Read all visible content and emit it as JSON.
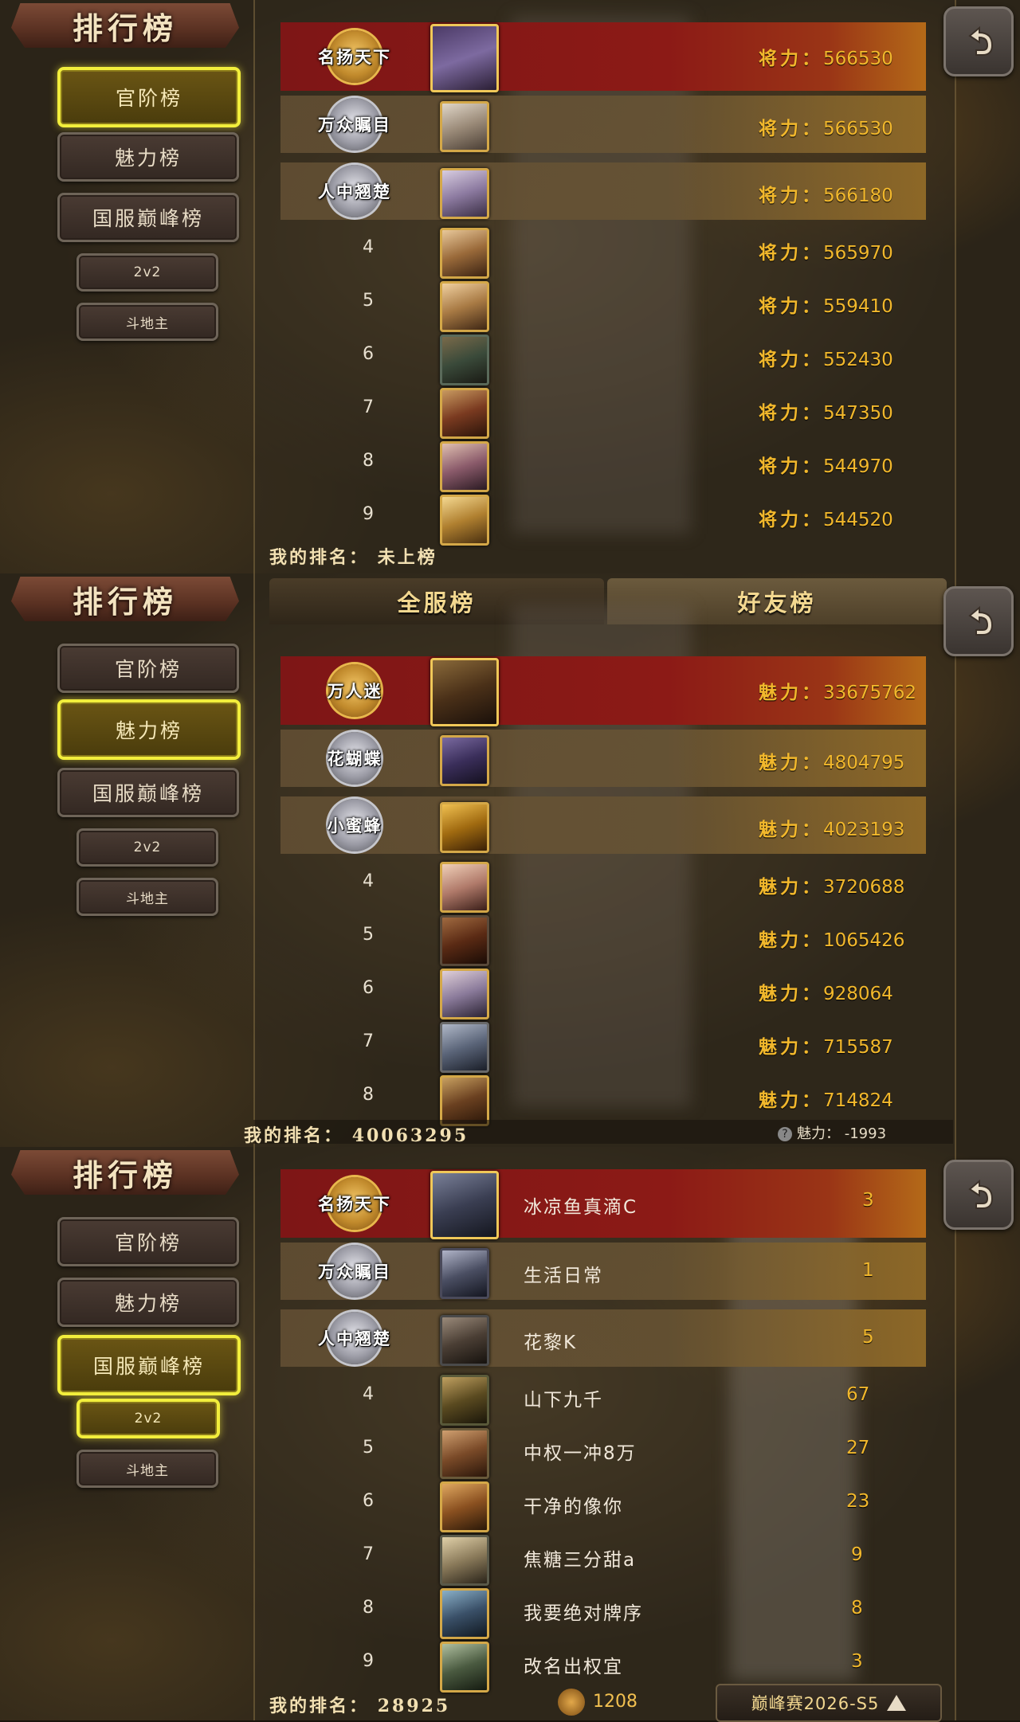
{
  "window": {
    "title": "排行榜"
  },
  "sidebar": {
    "items": [
      {
        "label": "官阶榜"
      },
      {
        "label": "魅力榜"
      },
      {
        "label": "国服巅峰榜"
      },
      {
        "label": "2v2"
      },
      {
        "label": "斗地主"
      }
    ]
  },
  "panels": [
    {
      "active_sidebar": "官阶榜",
      "score_label": "将力：",
      "rows": [
        {
          "rank": "1",
          "medal_text": "名扬天下",
          "score": "566530"
        },
        {
          "rank": "2",
          "medal_text": "万众瞩目",
          "score": "566530"
        },
        {
          "rank": "3",
          "medal_text": "人中翘楚",
          "score": "566180"
        },
        {
          "rank": "4",
          "score": "565970"
        },
        {
          "rank": "5",
          "score": "559410"
        },
        {
          "rank": "6",
          "score": "552430"
        },
        {
          "rank": "7",
          "score": "547350"
        },
        {
          "rank": "8",
          "score": "544970"
        },
        {
          "rank": "9",
          "score": "544520"
        }
      ],
      "my_rank_label": "我的排名：",
      "my_rank_value": "未上榜"
    },
    {
      "active_sidebar": "魅力榜",
      "tabs": [
        {
          "label": "全服榜"
        },
        {
          "label": "好友榜"
        }
      ],
      "score_label": "魅力：",
      "rows": [
        {
          "rank": "1",
          "medal_text": "万人迷",
          "score": "33675762"
        },
        {
          "rank": "2",
          "medal_text": "花蝴蝶",
          "score": "4804795"
        },
        {
          "rank": "3",
          "medal_text": "小蜜蜂",
          "score": "4023193"
        },
        {
          "rank": "4",
          "score": "3720688"
        },
        {
          "rank": "5",
          "score": "1065426"
        },
        {
          "rank": "6",
          "score": "928064"
        },
        {
          "rank": "7",
          "score": "715587"
        },
        {
          "rank": "8",
          "score": "714824"
        }
      ],
      "my_rank_label": "我的排名：",
      "my_rank_value": "40063295",
      "my_score_label": "魅力：",
      "my_score_value": "-1993"
    },
    {
      "active_sidebar": "国服巅峰榜",
      "active_sub": "2v2",
      "rows": [
        {
          "rank": "1",
          "medal_text": "名扬天下",
          "name": "冰凉鱼真滴C",
          "score_tail": "3"
        },
        {
          "rank": "2",
          "medal_text": "万众瞩目",
          "name": "生活日常",
          "score_tail": "1"
        },
        {
          "rank": "3",
          "medal_text": "人中翘楚",
          "name": "花黎K",
          "score_tail": "5"
        },
        {
          "rank": "4",
          "name": "山下九千",
          "score_tail": "67"
        },
        {
          "rank": "5",
          "name": "中权一冲8万",
          "score_tail": "27"
        },
        {
          "rank": "6",
          "name": "干净的像你",
          "score_tail": "23"
        },
        {
          "rank": "7",
          "name": "焦糖三分甜a",
          "score_tail": "9"
        },
        {
          "rank": "8",
          "name": "我要绝对牌序",
          "score_tail": "8"
        },
        {
          "rank": "9",
          "name": "改名出权宜",
          "score_tail": "3"
        }
      ],
      "my_rank_label": "我的排名：",
      "my_rank_value": "28925",
      "coins": "1208",
      "season": "巅峰赛2026-S5"
    }
  ],
  "colors": {
    "active_border": "#f2ee3c",
    "score_gold": "#f2b82c",
    "top1_red": "#8c1a16"
  },
  "icons": {
    "back": "back-arrow-icon",
    "help": "question-icon",
    "coin": "coin-icon",
    "expand": "triangle-up-icon"
  }
}
